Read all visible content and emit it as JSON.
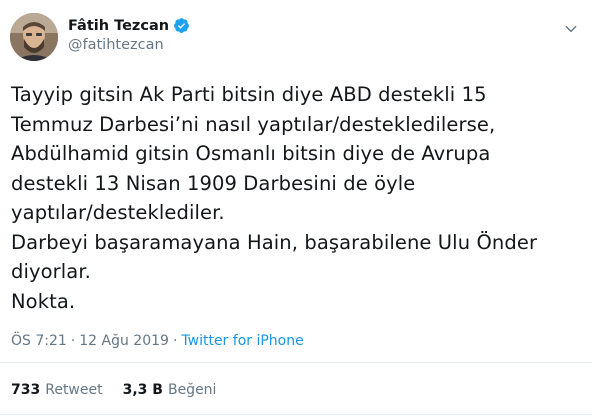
{
  "user": {
    "display_name": "Fâtih Tezcan",
    "handle": "@fatihtezcan",
    "verified": true,
    "avatar_icon": "user-avatar-photo",
    "verified_icon": "verified-badge-icon"
  },
  "tweet": {
    "text": "Tayyip gitsin Ak Parti bitsin diye ABD destekli 15\nTemmuz Darbesi’ni nasıl yaptılar/desteklediler​se,\nAbdülhamid gitsin Osmanlı bitsin diye de Avrupa\ndestekli 13 Nisan 1909 Darbesini de öyle\nyaptılar/desteklediler.\nDarbeyi başaramayana Hain, başarabilene Ulu Önder\ndiyorlar.\nNokta.",
    "time": "ÖS 7:21",
    "separator": "·",
    "date": "12 Ağu 2019",
    "source": "Twitter for iPhone"
  },
  "stats": {
    "retweets_count": "733",
    "retweets_label": "Retweet",
    "likes_count": "3,3 B",
    "likes_label": "Beğeni"
  },
  "colors": {
    "accent": "#1b95e0",
    "verified": "#1da1f2",
    "secondary_text": "#657786",
    "primary_text": "#14171a"
  }
}
